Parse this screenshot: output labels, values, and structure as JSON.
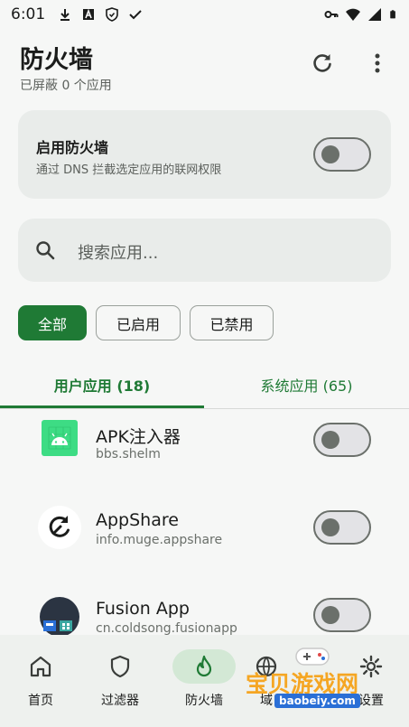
{
  "status_bar": {
    "time": "6:01",
    "left_icons": [
      "download-icon",
      "a-badge-icon",
      "shield-icon",
      "check-icon"
    ],
    "right_icons": [
      "key-icon",
      "wifi-icon",
      "signal-icon",
      "battery-icon"
    ]
  },
  "app_bar": {
    "title": "防火墙",
    "subtitle": "已屏蔽 0 个应用",
    "actions": [
      "refresh-icon",
      "more-vert-icon"
    ]
  },
  "firewall_card": {
    "title": "启用防火墙",
    "description": "通过 DNS 拦截选定应用的联网权限",
    "enabled": false
  },
  "search": {
    "placeholder": "搜索应用..."
  },
  "filters": [
    {
      "label": "全部",
      "active": true
    },
    {
      "label": "已启用",
      "active": false
    },
    {
      "label": "已禁用",
      "active": false
    }
  ],
  "tabs": [
    {
      "label": "用户应用 (18)",
      "selected": true
    },
    {
      "label": "系统应用 (65)",
      "selected": false
    }
  ],
  "apps": [
    {
      "name": "APK注入器",
      "package": "bbs.shelm",
      "enabled": false,
      "icon": "android-icon"
    },
    {
      "name": "AppShare",
      "package": "info.muge.appshare",
      "enabled": false,
      "icon": "appshare-icon"
    },
    {
      "name": "Fusion App",
      "package": "cn.coldsong.fusionapp",
      "enabled": false,
      "icon": "fusion-app-icon"
    }
  ],
  "bottom_nav": [
    {
      "label": "首页",
      "icon": "home-icon",
      "selected": false
    },
    {
      "label": "过滤器",
      "icon": "shield-icon",
      "selected": false
    },
    {
      "label": "防火墙",
      "icon": "flame-icon",
      "selected": true
    },
    {
      "label": "域",
      "icon": "domain-icon",
      "selected": false
    },
    {
      "label": "设置",
      "icon": "gear-icon",
      "selected": false
    }
  ],
  "watermark": {
    "text": "宝贝游戏网",
    "url": "baobeiy.com"
  },
  "colors": {
    "accent": "#1f7a35",
    "card": "#e9ecea",
    "background": "#f6f7f6"
  }
}
